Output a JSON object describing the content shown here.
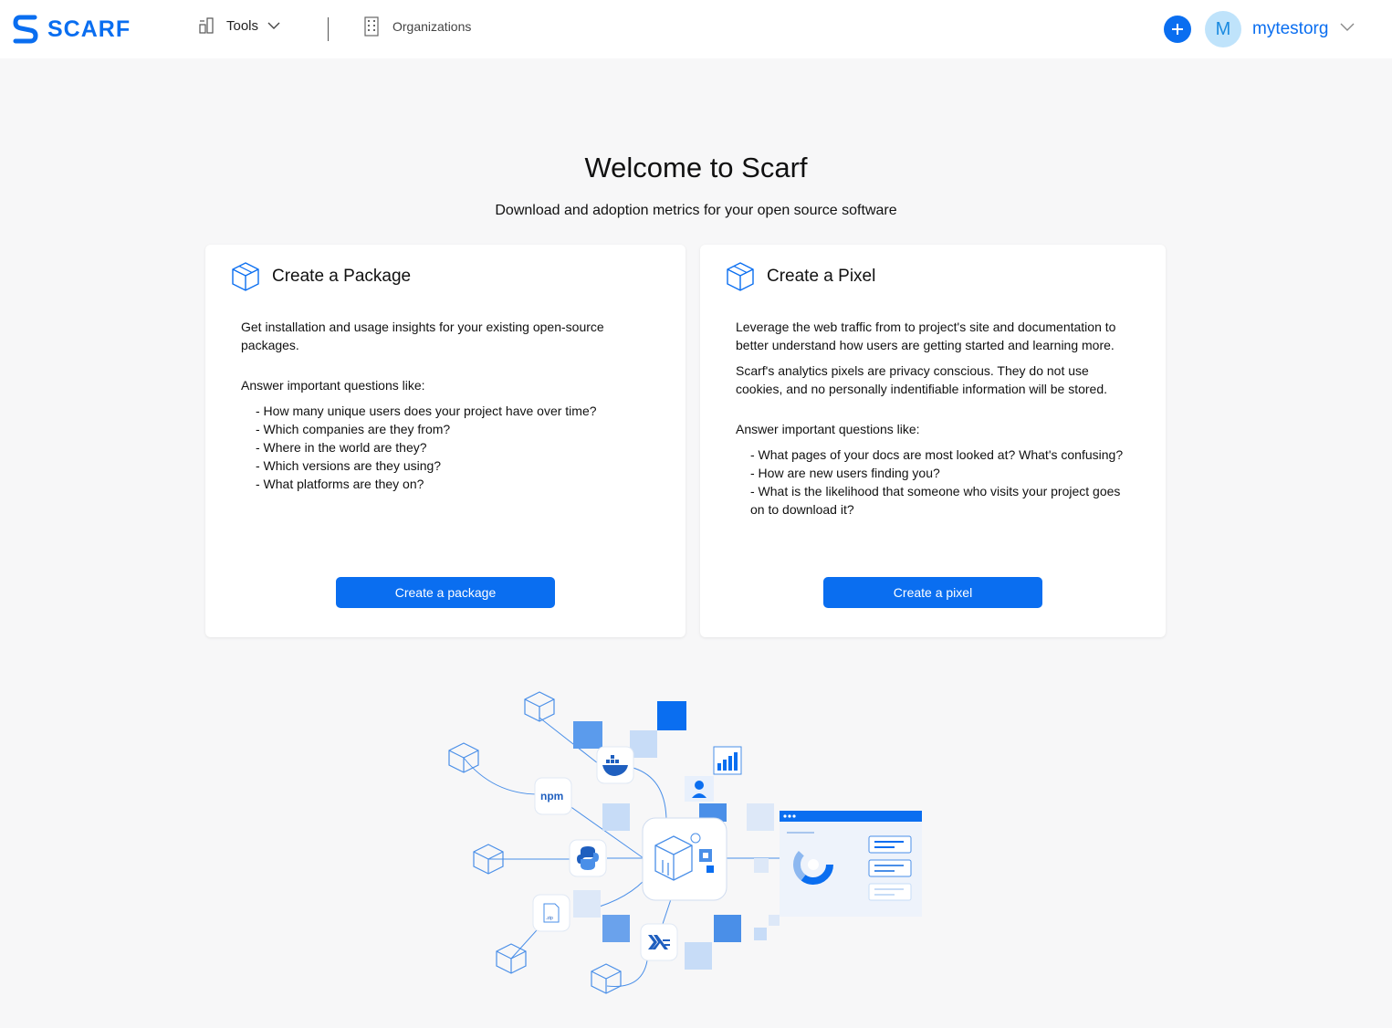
{
  "header": {
    "brand": "SCARF",
    "tools_label": "Tools",
    "organizations_label": "Organizations",
    "avatar_initial": "M",
    "org_name": "mytestorg"
  },
  "main": {
    "title": "Welcome to Scarf",
    "subtitle": "Download and adoption metrics for your open source software"
  },
  "package_card": {
    "title": "Create a Package",
    "intro": "Get installation and usage insights for your existing open-source packages.",
    "questions_heading": "Answer important questions like:",
    "questions": [
      "- How many unique users does your project have over time?",
      "- Which companies are they from?",
      "- Where in the world are they?",
      "- Which versions are they using?",
      "- What platforms are they on?"
    ],
    "button_label": "Create a package"
  },
  "pixel_card": {
    "title": "Create a Pixel",
    "intro": "Leverage the web traffic from to project's site and documentation to better understand how users are getting started and learning more.",
    "privacy": "Scarf's analytics pixels are privacy conscious. They do not use cookies, and no personally indentifiable information will be stored.",
    "questions_heading": "Answer important questions like:",
    "questions": [
      "- What pages of your docs are most looked at? What's confusing?",
      "- How are new users finding you?",
      "- What is the likelihood that someone who visits your project goes on to download it?"
    ],
    "button_label": "Create a pixel"
  },
  "illustration": {
    "npm_label": "npm"
  },
  "colors": {
    "accent": "#0a6ef0",
    "avatar_bg": "#bfe3fb",
    "page_bg": "#f7f7f8"
  },
  "icons": [
    "scarf-logo-icon",
    "tools-icon",
    "chevron-down-icon",
    "building-icon",
    "plus-icon",
    "package-box-icon"
  ]
}
